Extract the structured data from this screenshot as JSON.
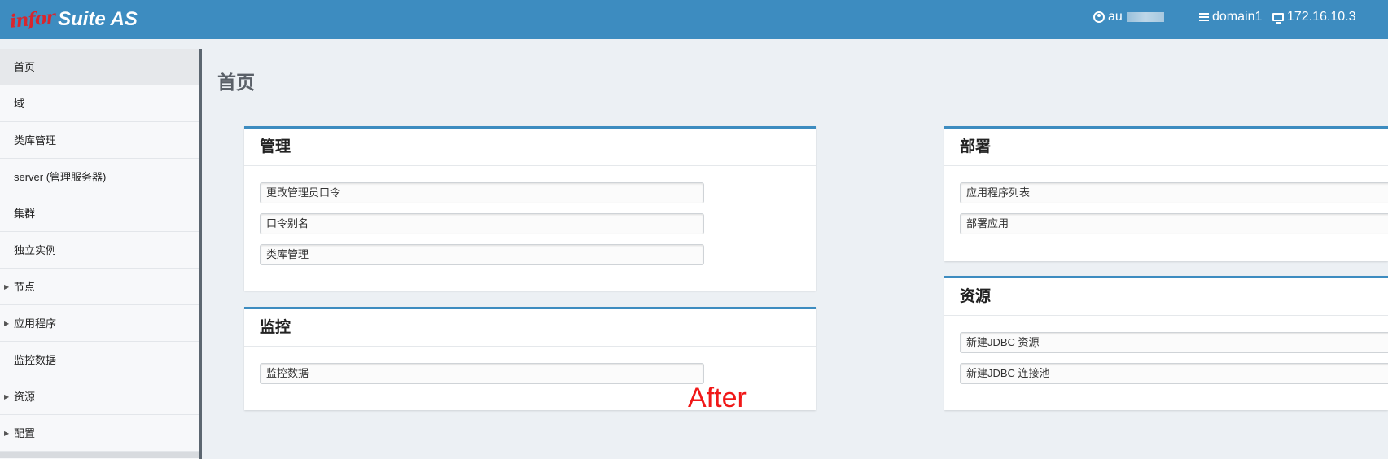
{
  "app": {
    "logo_brand": "infor",
    "logo_product": "Suite AS",
    "user_prefix": "au",
    "domain": "domain1",
    "ip": "172.16.10.3"
  },
  "sidebar": {
    "items": [
      {
        "label": "首页",
        "expandable": false,
        "active": true
      },
      {
        "label": "域",
        "expandable": false
      },
      {
        "label": "类库管理",
        "expandable": false
      },
      {
        "label": "server (管理服务器)",
        "expandable": false
      },
      {
        "label": "集群",
        "expandable": false
      },
      {
        "label": "独立实例",
        "expandable": false
      },
      {
        "label": "节点",
        "expandable": true
      },
      {
        "label": "应用程序",
        "expandable": true
      },
      {
        "label": "监控数据",
        "expandable": false
      },
      {
        "label": "资源",
        "expandable": true
      },
      {
        "label": "配置",
        "expandable": true
      }
    ]
  },
  "page": {
    "title": "首页"
  },
  "panels": {
    "manage": {
      "title": "管理",
      "links": [
        "更改管理员口令",
        "口令别名",
        "类库管理"
      ]
    },
    "monitor": {
      "title": "监控",
      "links": [
        "监控数据"
      ]
    },
    "deploy": {
      "title": "部署",
      "links": [
        "应用程序列表",
        "部署应用"
      ]
    },
    "resource": {
      "title": "资源",
      "links": [
        "新建JDBC 资源",
        "新建JDBC 连接池"
      ]
    }
  },
  "annotation": "After",
  "colors": {
    "topbar": "#3d8cc0",
    "panel_accent": "#3d8cc0",
    "annotation": "#f01818",
    "logo_brand": "#d8262d"
  }
}
